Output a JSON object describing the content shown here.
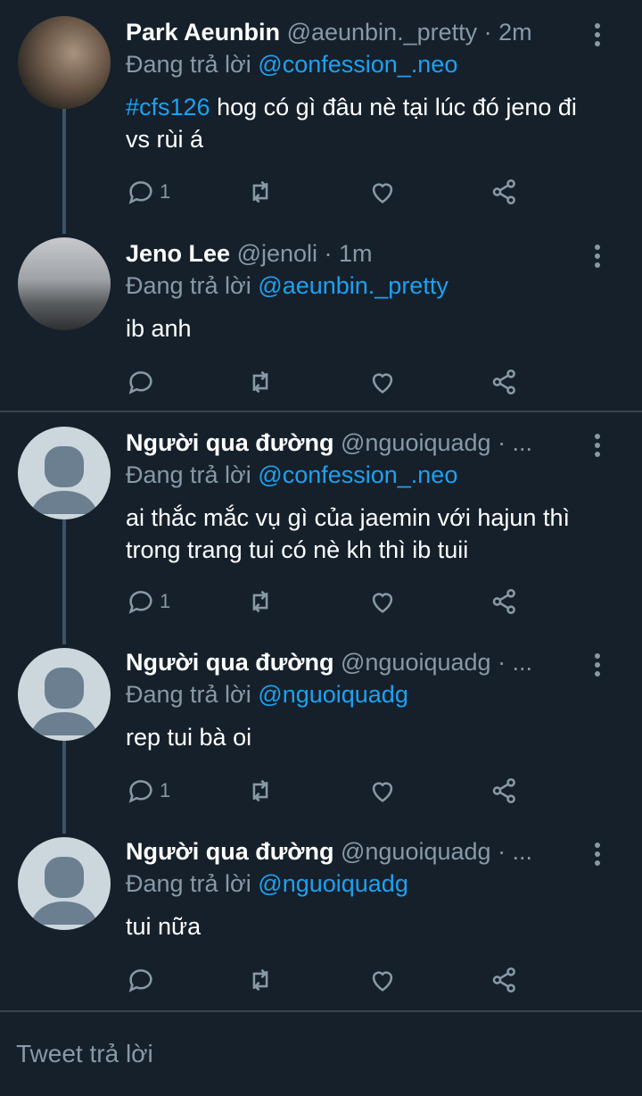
{
  "tweets": [
    {
      "name": "Park Aeunbin",
      "handle": "@aeunbin._pretty",
      "time": "· 2m",
      "reply_prefix": "Đang trả lời",
      "reply_to": "@confession_.neo",
      "hashtag": "#cfs126",
      "text": " hog có gì đâu nè tại lúc đó jeno đi vs rùi á",
      "reply_count": "1"
    },
    {
      "name": "Jeno Lee",
      "handle": "@jenoli",
      "time": "· 1m",
      "reply_prefix": "Đang trả lời",
      "reply_to": "@aeunbin._pretty",
      "text": "ib anh",
      "reply_count": ""
    },
    {
      "name": "Người qua đường",
      "handle": "@nguoiquadg",
      "time": "· ...",
      "reply_prefix": "Đang trả lời",
      "reply_to": "@confession_.neo",
      "text": "ai thắc mắc vụ gì của jaemin với hajun thì trong trang tui có nè kh thì ib tuii",
      "reply_count": "1"
    },
    {
      "name": "Người qua đường",
      "handle": "@nguoiquadg",
      "time": "· ...",
      "reply_prefix": "Đang trả lời",
      "reply_to": "@nguoiquadg",
      "text": "rep tui bà oi",
      "reply_count": "1"
    },
    {
      "name": "Người qua đường",
      "handle": "@nguoiquadg",
      "time": "· ...",
      "reply_prefix": "Đang trả lời",
      "reply_to": "@nguoiquadg",
      "text": "tui nữa",
      "reply_count": ""
    }
  ],
  "composer": {
    "placeholder": "Tweet trả lời"
  },
  "icons": [
    "reply-icon",
    "retweet-icon",
    "like-icon",
    "share-icon",
    "more-options-icon"
  ],
  "colors": {
    "background": "#15202b",
    "link": "#1da1f2",
    "muted": "#8899a6",
    "divider": "#38444d"
  }
}
